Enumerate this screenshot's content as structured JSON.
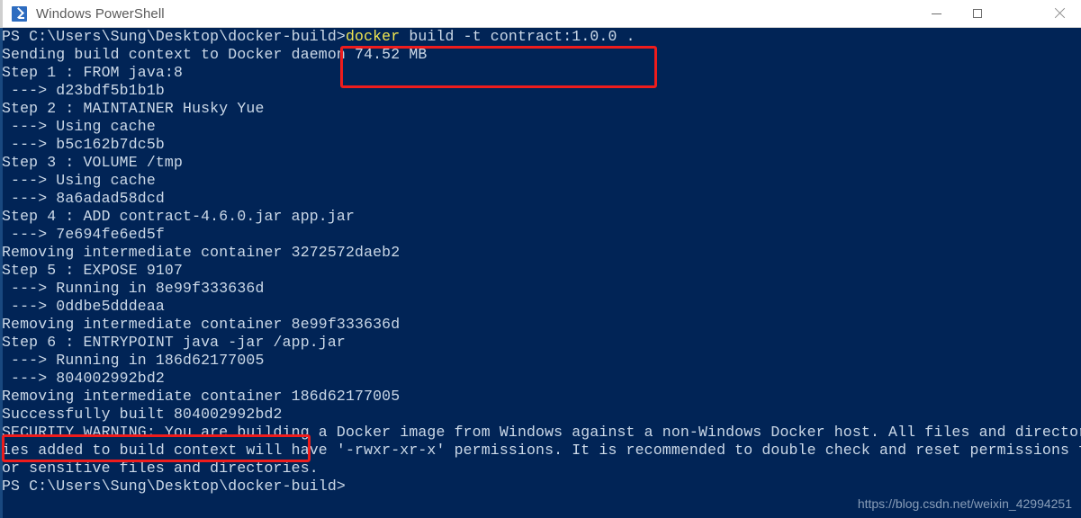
{
  "window": {
    "title": "Windows PowerShell",
    "icon": "powershell-icon",
    "background_color": "#012456",
    "text_color": "#ccd9e8",
    "titlebar_color": "#ffffff",
    "controls": {
      "minimize": "—",
      "maximize": "□",
      "close": "✕"
    }
  },
  "console": {
    "prompt": "PS C:\\Users\\Sung\\Desktop\\docker-build>",
    "command": {
      "program": "docker",
      "args": " build -t contract:1.0.0 .",
      "program_color": "#f2e750"
    },
    "lines": [
      "Sending build context to Docker daemon 74.52 MB",
      "Step 1 : FROM java:8",
      " ---> d23bdf5b1b1b",
      "Step 2 : MAINTAINER Husky Yue",
      " ---> Using cache",
      " ---> b5c162b7dc5b",
      "Step 3 : VOLUME /tmp",
      " ---> Using cache",
      " ---> 8a6adad58dcd",
      "Step 4 : ADD contract-4.6.0.jar app.jar",
      " ---> 7e694fe6ed5f",
      "Removing intermediate container 3272572daeb2",
      "Step 5 : EXPOSE 9107",
      " ---> Running in 8e99f333636d",
      " ---> 0ddbe5dddeaa",
      "Removing intermediate container 8e99f333636d",
      "Step 6 : ENTRYPOINT java -jar /app.jar",
      " ---> Running in 186d62177005",
      " ---> 804002992bd2",
      "Removing intermediate container 186d62177005",
      "Successfully built 804002992bd2",
      "SECURITY WARNING: You are building a Docker image from Windows against a non-Windows Docker host. All files and director",
      "ies added to build context will have '-rwxr-xr-x' permissions. It is recommended to double check and reset permissions f",
      "or sensitive files and directories."
    ],
    "final_prompt": "PS C:\\Users\\Sung\\Desktop\\docker-build>"
  },
  "annotations": {
    "color": "#ee1c1c",
    "command_box_label": "docker build -t contract:1.0.0 .",
    "success_box_label": "Successfully built 804002992bd2"
  },
  "watermark": {
    "text": "https://blog.csdn.net/weixin_42994251"
  }
}
